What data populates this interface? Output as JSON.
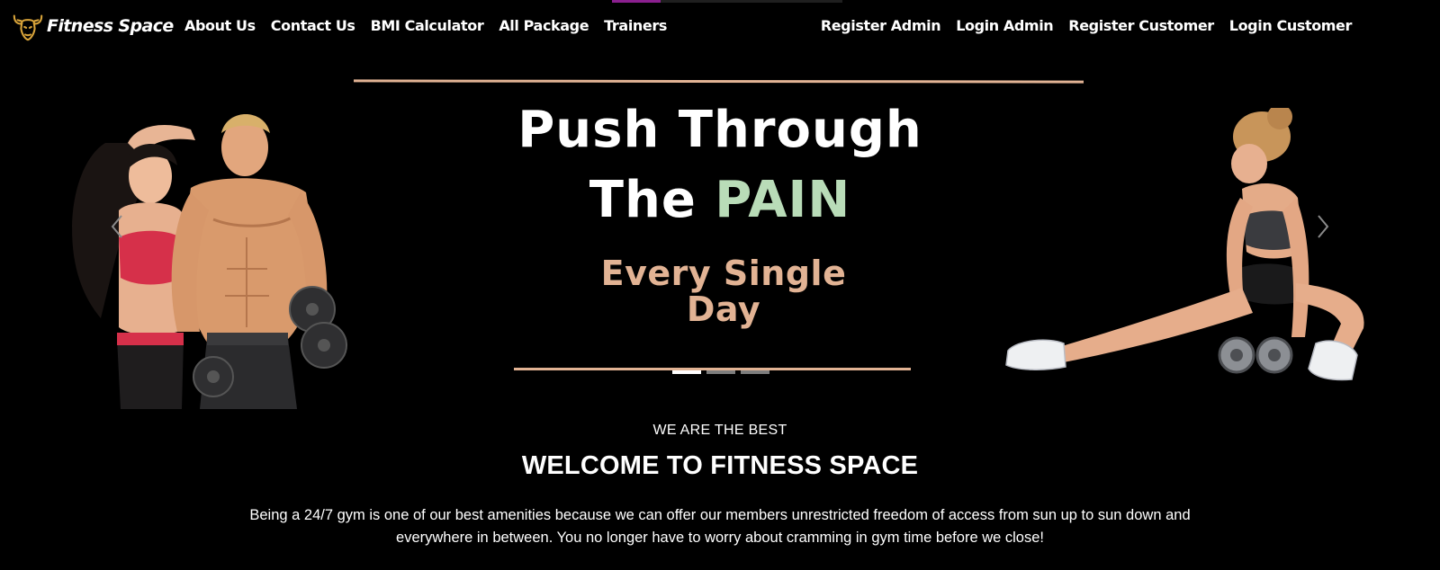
{
  "brand": {
    "name": "Fitness Space",
    "logo_icon": "bull-head-icon",
    "logo_color": "#d9a43a"
  },
  "nav": {
    "left": [
      {
        "label": "About Us"
      },
      {
        "label": "Contact Us"
      },
      {
        "label": "BMI Calculator"
      },
      {
        "label": "All Package"
      },
      {
        "label": "Trainers"
      }
    ],
    "right": [
      {
        "label": "Register Admin"
      },
      {
        "label": "Login Admin"
      },
      {
        "label": "Register Customer"
      },
      {
        "label": "Login Customer"
      }
    ]
  },
  "hero": {
    "line1": "Push Through",
    "line2_a": "The",
    "line2_b": "PAIN",
    "line3": "Every Single Day",
    "prev_icon": "chevron-left-icon",
    "next_icon": "chevron-right-icon",
    "slide_count": 3,
    "active_slide": 1,
    "colors": {
      "accent_line": "#e2b394",
      "pain": "#b9dcb8",
      "tagline": "#e2b394"
    }
  },
  "about": {
    "eyebrow": "WE ARE THE BEST",
    "title": "WELCOME TO FITNESS SPACE",
    "body": "Being a 24/7 gym is one of our best amenities because we can offer our members unrestricted freedom of access from sun up to sun down and everywhere in between. You no longer have to worry about cramming in gym time before we close!"
  }
}
